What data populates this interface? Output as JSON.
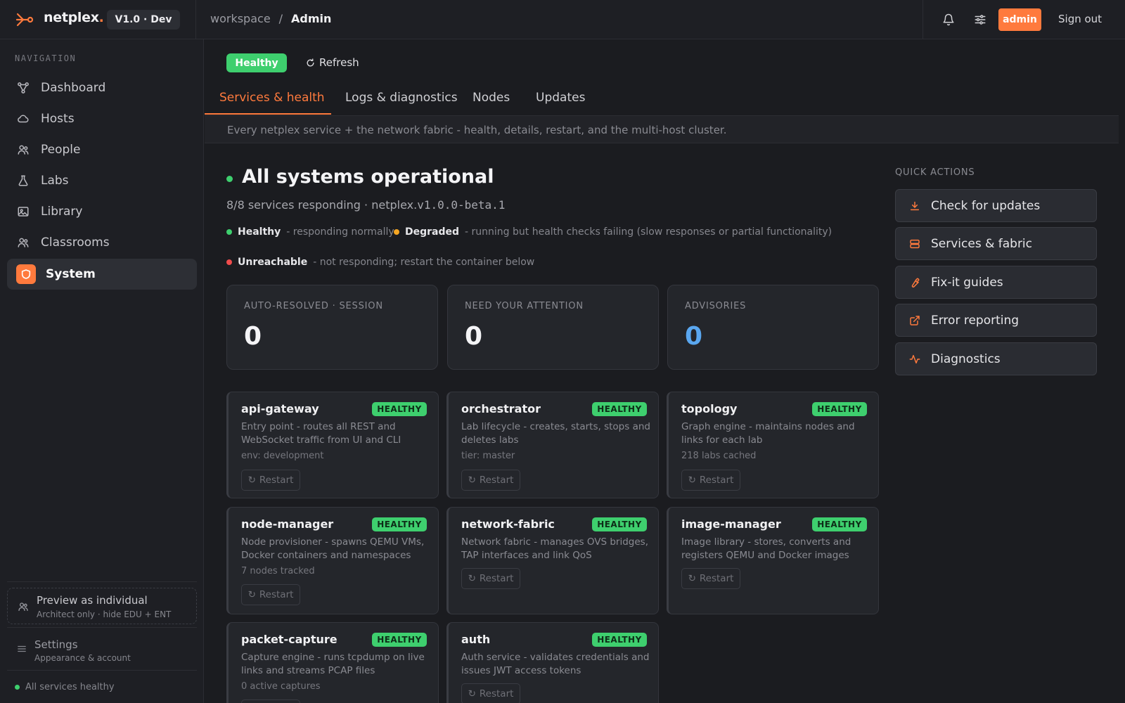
{
  "header": {
    "brand": "netplex",
    "brand_dot": ".",
    "version": "V1.0 · Dev",
    "breadcrumb": {
      "root": "workspace",
      "separator": "/",
      "current": "Admin"
    },
    "admin_label": "admin",
    "signout_label": "Sign out"
  },
  "sidebar": {
    "title": "NAVIGATION",
    "items": [
      {
        "label": "Dashboard",
        "icon": "topology-icon"
      },
      {
        "label": "Hosts",
        "icon": "cloud-icon"
      },
      {
        "label": "People",
        "icon": "people-icon"
      },
      {
        "label": "Labs",
        "icon": "flask-icon"
      },
      {
        "label": "Library",
        "icon": "image-icon"
      },
      {
        "label": "Classrooms",
        "icon": "people-icon"
      },
      {
        "label": "System",
        "icon": "shield-icon",
        "active": true
      }
    ],
    "preview": {
      "title": "Preview as individual",
      "subtitle": "Architect only · hide EDU + ENT"
    },
    "settings": {
      "title": "Settings",
      "subtitle": "Appearance & account"
    },
    "status": "All services healthy"
  },
  "main": {
    "health_pill": "Healthy",
    "refresh_label": "Refresh",
    "tabs": [
      {
        "label": "Services & health",
        "active": true
      },
      {
        "label": "Logs & diagnostics"
      },
      {
        "label": "Nodes"
      },
      {
        "label": "Updates"
      }
    ],
    "description": "Every netplex service + the network fabric - health, details, restart, and the multi-host cluster.",
    "headline": "All systems operational",
    "subline_prefix": "8/8 services responding · netplex.",
    "subline_version": "v1.0.0-beta.1",
    "legend": [
      {
        "label": "Healthy",
        "text": "- responding normally",
        "color": "#3ecf6e"
      },
      {
        "label": "Degraded",
        "text": "- running but health checks failing (slow responses or partial functionality)",
        "color": "#f5a623"
      },
      {
        "label": "Unreachable",
        "text": "- not responding; restart the container below",
        "color": "#f04c4c"
      }
    ],
    "stats": [
      {
        "label": "AUTO-RESOLVED · SESSION",
        "value": "0"
      },
      {
        "label": "NEED YOUR ATTENTION",
        "value": "0"
      },
      {
        "label": "ADVISORIES",
        "value": "0"
      }
    ],
    "restart_label": "Restart",
    "services": [
      {
        "name": "api-gateway",
        "status": "HEALTHY",
        "desc": "Entry point - routes all REST and WebSocket traffic from UI and CLI",
        "meta": "env: development"
      },
      {
        "name": "orchestrator",
        "status": "HEALTHY",
        "desc": "Lab lifecycle - creates, starts, stops and deletes labs",
        "meta": "tier: master"
      },
      {
        "name": "topology",
        "status": "HEALTHY",
        "desc": "Graph engine - maintains nodes and links for each lab",
        "meta": "218 labs cached"
      },
      {
        "name": "node-manager",
        "status": "HEALTHY",
        "desc": "Node provisioner - spawns QEMU VMs, Docker containers and namespaces",
        "meta": "7 nodes tracked"
      },
      {
        "name": "network-fabric",
        "status": "HEALTHY",
        "desc": "Network fabric - manages OVS bridges, TAP interfaces and link QoS",
        "meta": ""
      },
      {
        "name": "image-manager",
        "status": "HEALTHY",
        "desc": "Image library - stores, converts and registers QEMU and Docker images",
        "meta": ""
      },
      {
        "name": "packet-capture",
        "status": "HEALTHY",
        "desc": "Capture engine - runs tcpdump on live links and streams PCAP files",
        "meta": "0 active captures"
      },
      {
        "name": "auth",
        "status": "HEALTHY",
        "desc": "Auth service - validates credentials and issues JWT access tokens",
        "meta": ""
      }
    ]
  },
  "quick_actions": {
    "title": "QUICK ACTIONS",
    "items": [
      {
        "label": "Check for updates",
        "icon": "download-icon"
      },
      {
        "label": "Services & fabric",
        "icon": "server-icon"
      },
      {
        "label": "Fix-it guides",
        "icon": "wrench-icon"
      },
      {
        "label": "Error reporting",
        "icon": "external-link-icon"
      },
      {
        "label": "Diagnostics",
        "icon": "pulse-icon"
      }
    ]
  },
  "colors": {
    "accent": "#ff7a3d",
    "healthy": "#3ecf6e",
    "advisory": "#5aa7f0"
  }
}
